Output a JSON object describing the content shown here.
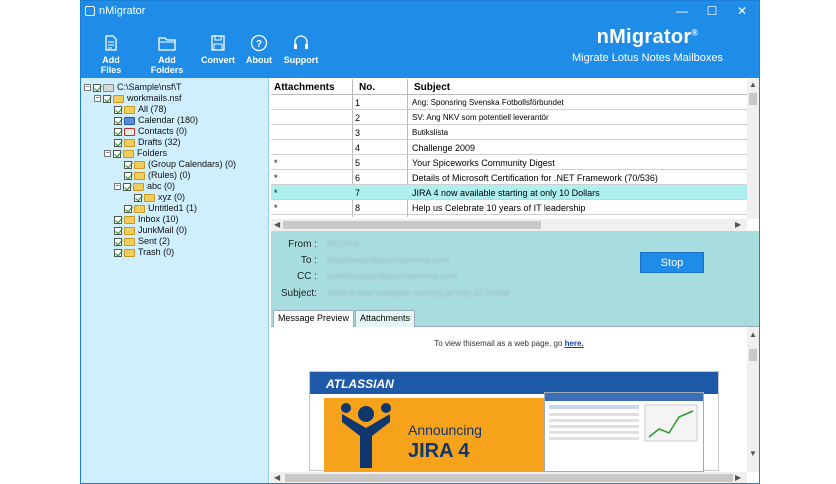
{
  "window": {
    "title": "nMigrator",
    "minimize": "—",
    "maximize": "☐",
    "close": "✕"
  },
  "toolbar": [
    {
      "label": "Add Files",
      "icon": "add-files-icon"
    },
    {
      "label": "Add Folders",
      "icon": "add-folders-icon"
    },
    {
      "label": "Convert",
      "icon": "convert-icon"
    },
    {
      "label": "About",
      "icon": "about-icon"
    },
    {
      "label": "Support",
      "icon": "support-icon"
    }
  ],
  "brand": {
    "name": "nMigrator",
    "mark": "®",
    "tagline": "Migrate Lotus Notes Mailboxes"
  },
  "tree": {
    "root": "C:\\Sample\\nsf\\T",
    "file": "workmails.nsf",
    "items": [
      "All (78)",
      "Calendar (180)",
      "Contacts (0)",
      "Drafts (32)",
      "Folders",
      "(Group Calendars) (0)",
      "(Rules) (0)",
      "abc (0)",
      "xyz (0)",
      "Untitled1 (1)",
      "Inbox (10)",
      "JunkMail (0)",
      "Sent (2)",
      "Trash (0)"
    ]
  },
  "grid": {
    "headers": {
      "attachments": "Attachments",
      "no": "No.",
      "subject": "Subject"
    },
    "rows": [
      {
        "att": "",
        "no": "1",
        "subject": "Ang: Sponsring Svenska Fotbollsförbundet"
      },
      {
        "att": "",
        "no": "2",
        "subject": "SV: Ang NKV som potentiell leverantör"
      },
      {
        "att": "",
        "no": "3",
        "subject": "Butikslista"
      },
      {
        "att": "",
        "no": "4",
        "subject": "Challenge 2009"
      },
      {
        "att": "*",
        "no": "5",
        "subject": "Your Spiceworks Community Digest"
      },
      {
        "att": "*",
        "no": "6",
        "subject": "Details of Microsoft Certification for .NET Framework (70/536)"
      },
      {
        "att": "*",
        "no": "7",
        "subject": "JIRA 4 now available starting at only 10 Dollars"
      },
      {
        "att": "*",
        "no": "8",
        "subject": "Help us Celebrate 10 years of IT leadership"
      }
    ],
    "selected_row": 7
  },
  "details": {
    "from_label": "From :",
    "to_label": "To :",
    "cc_label": "CC :",
    "subject_label": "Subject:",
    "from_value": "RCUITA",
    "to_value": "bwanbwan@pcchatemms.com",
    "cc_value": "bubkbiuydsa@pcchatemms.com",
    "subject_value": "JIRA 4 now available starting at only 10 Dollar",
    "stop_label": "Stop"
  },
  "tabs": {
    "preview": "Message Preview",
    "attachments": "Attachments"
  },
  "preview": {
    "note_text": "To view thisemail as a web page, go ",
    "note_link": "here.",
    "logo": "ATLASSIAN",
    "announce": "Announcing",
    "big": "JIRA 4"
  },
  "colors": {
    "accent": "#1f8ce8",
    "tree_bg": "#cfeefe",
    "details_bg": "#a8dde0",
    "selected_row": "#aef0ef"
  }
}
